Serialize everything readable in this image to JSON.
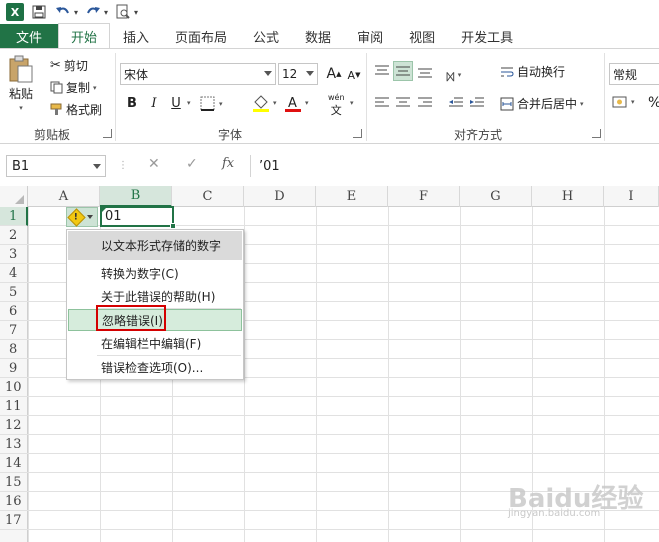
{
  "qat": {
    "logo": "X",
    "more": "▾"
  },
  "tabs": [
    "文件",
    "开始",
    "插入",
    "页面布局",
    "公式",
    "数据",
    "审阅",
    "视图",
    "开发工具"
  ],
  "ribbon": {
    "clipboard": {
      "paste": "粘贴",
      "cut": "剪切",
      "copy": "复制",
      "format_painter": "格式刷",
      "label": "剪贴板"
    },
    "font": {
      "name": "宋体",
      "size": "12",
      "bold": "B",
      "italic": "I",
      "underline": "U",
      "label": "字体",
      "grow": "A",
      "shrink": "A",
      "wen": "wén"
    },
    "alignment": {
      "wrap": "自动换行",
      "merge": "合并后居中",
      "label": "对齐方式"
    },
    "number": {
      "format": "常规",
      "percent": "%"
    }
  },
  "formula_bar": {
    "name_box": "B1",
    "fx": "fx",
    "cancel": "✕",
    "enter": "✓",
    "content": "’01"
  },
  "grid": {
    "columns": [
      "A",
      "B",
      "C",
      "D",
      "E",
      "F",
      "G",
      "H",
      "I"
    ],
    "rows": [
      "1",
      "2",
      "3",
      "4",
      "5",
      "6",
      "7",
      "8",
      "9",
      "10",
      "11",
      "12",
      "13",
      "14",
      "15",
      "16",
      "17"
    ],
    "selected_column": "B",
    "selected_row": "1",
    "b1_value": "01"
  },
  "error_menu": {
    "header": "以文本形式存储的数字",
    "items": [
      {
        "label": "转换为数字(C)"
      },
      {
        "label": "关于此错误的帮助(H)"
      },
      {
        "label": "忽略错误(I)"
      },
      {
        "label": "在编辑栏中编辑(F)"
      },
      {
        "label": "错误检查选项(O)..."
      }
    ],
    "highlighted": "忽略错误(I)"
  },
  "watermark": {
    "text": "Baidu经验",
    "url": "jingyan.baidu.com"
  },
  "colors": {
    "accent": "#217346",
    "highlight": "#d6ecdc",
    "callout": "#d40000"
  }
}
